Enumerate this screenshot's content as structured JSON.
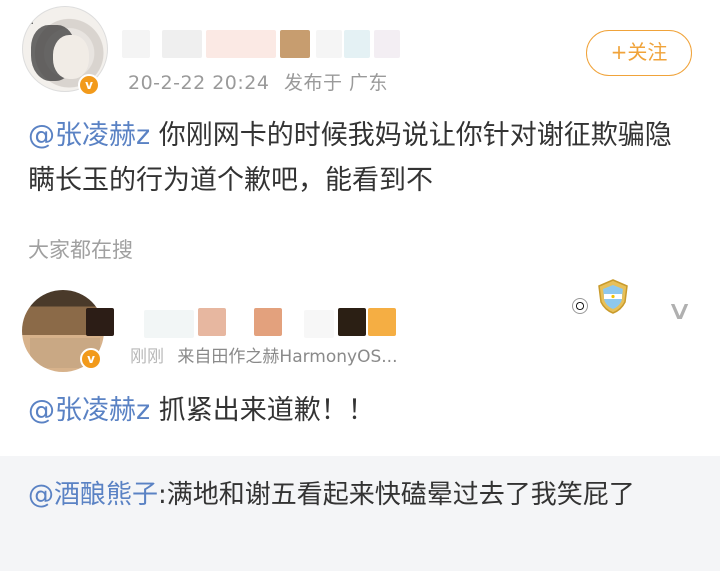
{
  "post": {
    "avatar_icon": "avatar-portrait",
    "verified_icon": "verified-badge-icon",
    "time_suffix": "2-22 20:24",
    "location": "发布于 广东",
    "follow_label": "+关注",
    "mention": "@张凌赫z",
    "body": " 你刚网卡的时候我妈说让你针对谢征欺骗隐瞒长玉的行为道个歉吧，能看到不"
  },
  "search_section": {
    "label": "大家都在搜"
  },
  "comment": {
    "source_prefix": "刚刚",
    "source": "来自田作之赫HarmonyOS...",
    "mention": "@张凌赫z",
    "body": " 抓紧出来道歉！！",
    "chevron_icon": "chevron-down-icon",
    "badge_icons": [
      "soccer-ball-icon",
      "argentina-shield-icon"
    ]
  },
  "reply": {
    "author": "@酒酿熊子",
    "body": ":满地和谢五看起来快磕晕过去了我笑屁了"
  },
  "colors": {
    "accent": "#f0a33a",
    "mention": "#5a82c4",
    "reply_bg": "#f4f5f7"
  }
}
